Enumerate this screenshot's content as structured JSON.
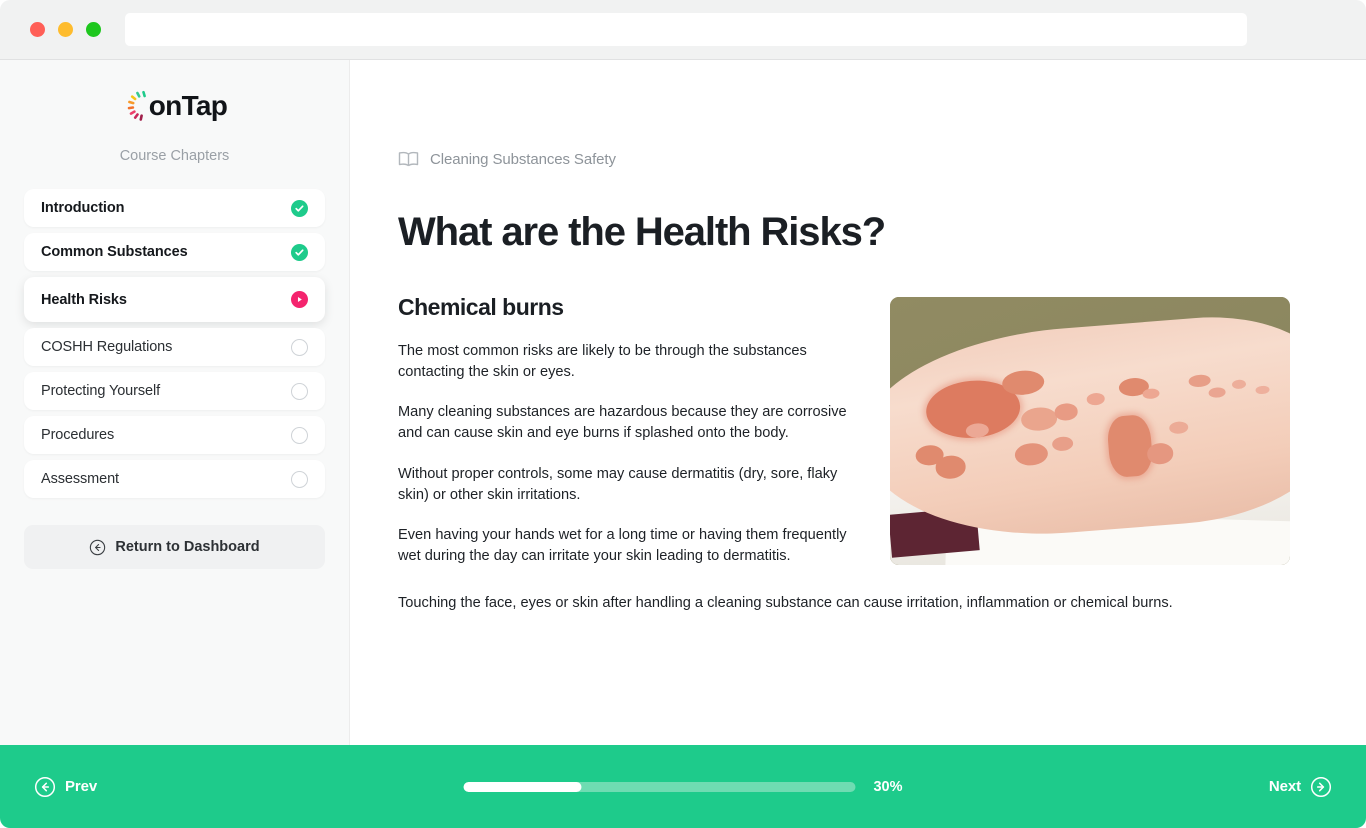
{
  "browser": {
    "address_value": "",
    "address_placeholder": ""
  },
  "sidebar": {
    "logo_text": "onTap",
    "heading": "Course Chapters",
    "chapters": [
      {
        "label": "Introduction",
        "state": "done"
      },
      {
        "label": "Common Substances",
        "state": "done"
      },
      {
        "label": "Health Risks",
        "state": "current"
      },
      {
        "label": "COSHH Regulations",
        "state": "pending"
      },
      {
        "label": "Protecting Yourself",
        "state": "pending"
      },
      {
        "label": "Procedures",
        "state": "pending"
      },
      {
        "label": "Assessment",
        "state": "pending"
      }
    ],
    "return_label": "Return to Dashboard"
  },
  "main": {
    "breadcrumb": "Cleaning Substances Safety",
    "title": "What are the Health Risks?",
    "section_title": "Chemical burns",
    "paragraphs": [
      "The most common risks are likely to be through the substances contacting the skin or eyes.",
      "Many cleaning substances are hazardous because they are corrosive and can cause skin and eye burns if splashed onto the body.",
      "Without proper controls, some may cause dermatitis (dry, sore, flaky skin) or other skin irritations.",
      "Even having your hands wet for a long time or having them frequently wet during the day can irritate your skin leading to dermatitis."
    ],
    "full_width_paragraph": "Touching the face, eyes or skin after handling a cleaning substance can cause irritation, inflammation or chemical burns.",
    "image_alt": "Forearm with red inflamed dermatitis patches resting on white paper"
  },
  "footer": {
    "prev_label": "Prev",
    "next_label": "Next",
    "progress_percent": "30%",
    "progress_value": 30
  },
  "colors": {
    "accent_green": "#1ecb8b",
    "accent_pink": "#f4246e",
    "sidebar_bg": "#f8f9f9",
    "text_primary": "#1b1f24",
    "text_muted": "#8e949a"
  }
}
